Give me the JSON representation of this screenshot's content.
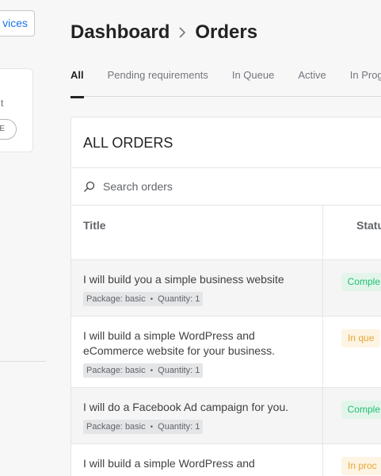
{
  "sidebar": {
    "services_button": "vices",
    "card_text": "t",
    "pill_text": "E"
  },
  "header": {
    "crumb_root": "Dashboard",
    "crumb_current": "Orders"
  },
  "tabs": [
    {
      "label": "All",
      "active": true
    },
    {
      "label": "Pending requirements",
      "active": false
    },
    {
      "label": "In Queue",
      "active": false
    },
    {
      "label": "Active",
      "active": false
    },
    {
      "label": "In Prog",
      "active": false
    }
  ],
  "orders_card": {
    "title": "ALL ORDERS",
    "search_placeholder": "Search orders",
    "columns": {
      "title": "Title",
      "status": "Statu"
    },
    "rows": [
      {
        "name": "I will build you a simple business website",
        "package_label": "Package:",
        "package": "basic",
        "quantity": "Quantity: 1",
        "status": "Comple"
      },
      {
        "name": "I will build a simple WordPress and eCommerce website for your business.",
        "package_label": "Package:",
        "package": "basic",
        "quantity": "Quantity: 1",
        "status": "In que"
      },
      {
        "name": "I will do a Facebook Ad campaign for you.",
        "package_label": "Package:",
        "package": "basic",
        "quantity": "Quantity: 1",
        "status": "Comple"
      },
      {
        "name": "I will build a simple WordPress and",
        "package_label": "",
        "package": "",
        "quantity": "",
        "status": "In proc"
      }
    ]
  },
  "colors": {
    "complete": "#1dbf73",
    "queue": "#e7a737",
    "link": "#1a73e8"
  }
}
